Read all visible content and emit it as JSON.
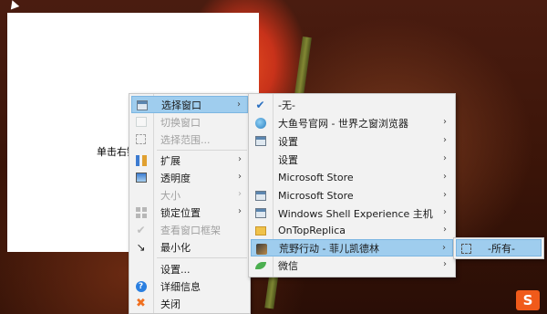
{
  "background": {
    "accent": "#c8321a"
  },
  "window": {
    "hint_text": "单击右键"
  },
  "menu_main": {
    "items": [
      {
        "label": "选择窗口",
        "icon": "window-icon",
        "selected": true,
        "submenu": true,
        "disabled": false
      },
      {
        "label": "切换窗口",
        "icon": "switch-icon",
        "selected": false,
        "submenu": false,
        "disabled": true
      },
      {
        "label": "选择范围...",
        "icon": "region-icon",
        "selected": false,
        "submenu": false,
        "disabled": true
      },
      {
        "label": "扩展",
        "icon": "tools-icon",
        "selected": false,
        "submenu": true,
        "disabled": false
      },
      {
        "label": "透明度",
        "icon": "opacity-icon",
        "selected": false,
        "submenu": true,
        "disabled": false
      },
      {
        "label": "大小",
        "icon": "",
        "selected": false,
        "submenu": true,
        "disabled": true
      },
      {
        "label": "锁定位置",
        "icon": "lock-grid-icon",
        "selected": false,
        "submenu": true,
        "disabled": false
      },
      {
        "label": "查看窗口框架",
        "icon": "check-icon",
        "selected": false,
        "submenu": false,
        "disabled": true
      },
      {
        "label": "最小化",
        "icon": "minimize-icon",
        "selected": false,
        "submenu": false,
        "disabled": false
      },
      {
        "label": "设置...",
        "icon": "",
        "selected": false,
        "submenu": false,
        "disabled": false
      },
      {
        "label": "详细信息",
        "icon": "info-icon",
        "selected": false,
        "submenu": false,
        "disabled": false
      },
      {
        "label": "关闭",
        "icon": "close-icon",
        "selected": false,
        "submenu": false,
        "disabled": false
      }
    ]
  },
  "menu_windows": {
    "items": [
      {
        "label": "-无-",
        "icon": "check-icon",
        "submenu": false,
        "selected": false
      },
      {
        "label": "大鱼号官网 - 世界之窗浏览器",
        "icon": "browser-globe-icon",
        "submenu": true,
        "selected": false
      },
      {
        "label": "设置",
        "icon": "window-icon",
        "submenu": true,
        "selected": false
      },
      {
        "label": "设置",
        "icon": "",
        "submenu": true,
        "selected": false
      },
      {
        "label": "Microsoft Store",
        "icon": "",
        "submenu": true,
        "selected": false
      },
      {
        "label": "Microsoft Store",
        "icon": "window-icon",
        "submenu": true,
        "selected": false
      },
      {
        "label": "Windows Shell Experience 主机",
        "icon": "window-icon",
        "submenu": true,
        "selected": false
      },
      {
        "label": "OnTopReplica",
        "icon": "folder-icon",
        "submenu": true,
        "selected": false
      },
      {
        "label": "荒野行动 - 菲儿凯德林",
        "icon": "game-icon",
        "submenu": true,
        "selected": true
      },
      {
        "label": "微信",
        "icon": "wechat-leaf-icon",
        "submenu": true,
        "selected": false
      }
    ]
  },
  "menu_region": {
    "items": [
      {
        "label": "-所有-",
        "icon": "region-dashed-icon"
      }
    ]
  },
  "tray": {
    "ime_label": "S"
  }
}
